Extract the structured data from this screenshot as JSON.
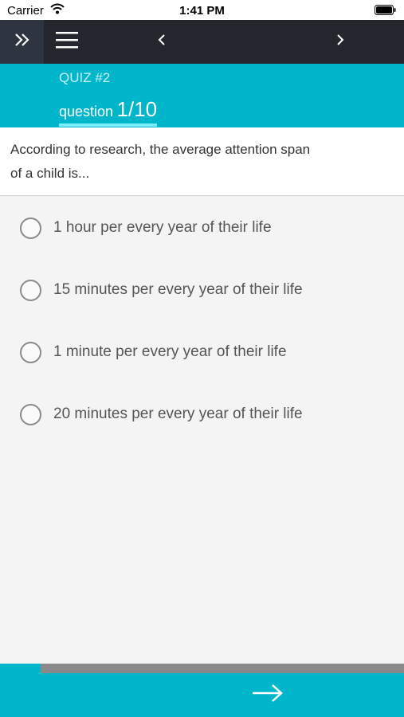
{
  "status_bar": {
    "carrier": "Carrier",
    "time": "1:41 PM"
  },
  "nav": {
    "expand_icon": "double-chevron-right-icon",
    "menu_icon": "hamburger-icon",
    "prev_icon": "chevron-left-icon",
    "next_icon": "chevron-right-icon"
  },
  "quiz": {
    "title": "QUIZ #2",
    "question_word": "question",
    "question_number": "1/10"
  },
  "question": {
    "text": "According to research, the average attention span of a child is..."
  },
  "options": [
    {
      "label": "1 hour per every year of their life"
    },
    {
      "label": "15 minutes per every year of their life"
    },
    {
      "label": "1 minute per every year of their life"
    },
    {
      "label": "20 minutes per every year of their life"
    }
  ],
  "progress": {
    "fraction": 0.1
  },
  "footer": {
    "next_icon": "arrow-right-icon"
  },
  "colors": {
    "accent": "#00b6cb",
    "nav_bg": "#23272d",
    "progress_track": "#8a8a8a"
  }
}
